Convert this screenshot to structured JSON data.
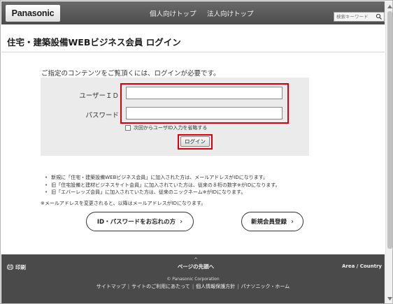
{
  "header": {
    "logo": "Panasonic",
    "nav": [
      "個人向けトップ",
      "法人向けトップ"
    ],
    "search_placeholder": "検索キーワード"
  },
  "page": {
    "title": "住宅・建築設備WEBビジネス会員 ログイン",
    "notice": "ご指定のコンテンツをご覧頂くには、ログインが必要です。"
  },
  "form": {
    "userid_label": "ユーザーＩＤ",
    "password_label": "パスワード",
    "userid_value": "",
    "password_value": "",
    "remember_label": "次回からユーザID入力を省略する",
    "login_button": "ログイン"
  },
  "notes": [
    "新規に「住宅・建築設備WEBビジネス会員」に加入された方は、メールアドレスがIDになります。",
    "旧「住宅設備と建材ビジネスサイト会員」に加入されていた方は、従来の８桁の数字※がIDになります。",
    "旧「エバーレッズ会員」に加入されていた方は、従来のニックネーム※がIDになります。"
  ],
  "note_extra": "※メールアドレスを変更されると、以降はメールアドレスがIDになります。",
  "buttons": {
    "forgot": "ID・パスワードをお忘れの方",
    "register": "新規会員登録"
  },
  "footer": {
    "print": "印刷",
    "back_to_top": "ページの先頭へ",
    "area": "Area / Country",
    "copyright": "© Panasonic Corporation",
    "links": [
      "サイトマップ",
      "サイトのご利用にあたって",
      "個人情報保護方針",
      "パナソニック・ホーム"
    ]
  },
  "colors": {
    "highlight": "#d9000e",
    "header_bg": "#555555",
    "footer_bg": "#4a4a4a",
    "form_bg": "#ebebeb"
  },
  "icons": [
    "search-icon",
    "printer-icon",
    "chevron-right-icon",
    "chevron-up-icon"
  ]
}
